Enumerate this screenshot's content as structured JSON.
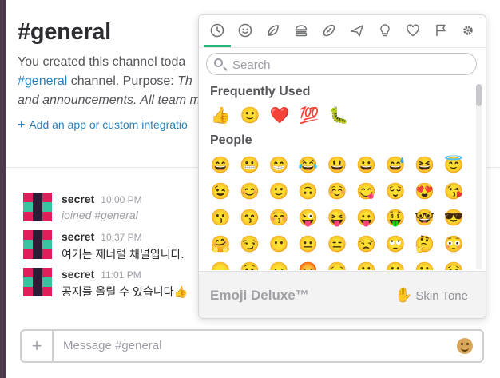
{
  "channel": {
    "title": "#general",
    "intro_line1": "You created this channel toda",
    "intro_link": "#general",
    "intro_mid": " channel. Purpose: ",
    "intro_purpose_start": "Th",
    "intro_line3": "and announcements. All team m",
    "add_app_plus": "+",
    "add_app_label": "Add an app or custom integratio"
  },
  "messages": [
    {
      "author": "secret",
      "time": "10:00 PM",
      "text": "joined #general",
      "muted": true
    },
    {
      "author": "secret",
      "time": "10:37 PM",
      "text": "여기는 제너럴 채널입니다.",
      "muted": false
    },
    {
      "author": "secret",
      "time": "11:01 PM",
      "text": "공지를 올릴 수 있습니다👍",
      "muted": false
    }
  ],
  "composer": {
    "plus_label": "+",
    "placeholder": "Message #general",
    "emoji_icon": "smiley-face-icon"
  },
  "picker": {
    "tabs": [
      {
        "name": "recent",
        "icon": "clock-icon",
        "active": true
      },
      {
        "name": "people",
        "icon": "smiley-icon"
      },
      {
        "name": "nature",
        "icon": "leaf-icon"
      },
      {
        "name": "food",
        "icon": "burger-icon"
      },
      {
        "name": "activity",
        "icon": "football-icon"
      },
      {
        "name": "travel",
        "icon": "airplane-icon"
      },
      {
        "name": "objects",
        "icon": "lightbulb-icon"
      },
      {
        "name": "symbols",
        "icon": "heart-icon"
      },
      {
        "name": "flags",
        "icon": "flag-icon"
      },
      {
        "name": "custom",
        "icon": "gear-icon"
      }
    ],
    "search_placeholder": "Search",
    "frequently_used_title": "Frequently Used",
    "frequently_used": [
      "👍",
      "🙂",
      "❤️",
      "💯",
      "🐛"
    ],
    "people_title": "People",
    "people": [
      [
        "😄",
        "😬",
        "😁",
        "😂",
        "😃",
        "😀",
        "😅",
        "😆",
        "😇"
      ],
      [
        "😉",
        "😊",
        "🙂",
        "🙃",
        "☺️",
        "😋",
        "😌",
        "😍",
        "😘"
      ],
      [
        "😗",
        "😙",
        "😚",
        "😜",
        "😝",
        "😛",
        "🤑",
        "🤓",
        "😎"
      ],
      [
        "🤗",
        "😏",
        "😶",
        "😐",
        "😑",
        "😒",
        "🙄",
        "🤔",
        "😳"
      ],
      [
        "😞",
        "😟",
        "😠",
        "😡",
        "😔",
        "😕",
        "🙁",
        "☹️",
        "😣"
      ]
    ],
    "brand": "Emoji Deluxe™",
    "skin_tone_hand": "✋",
    "skin_tone_label": "Skin Tone"
  },
  "colors": {
    "accent_link": "#2a80b9",
    "active_tab_underline": "#2ab27b",
    "sidebar": "#4d394b"
  }
}
